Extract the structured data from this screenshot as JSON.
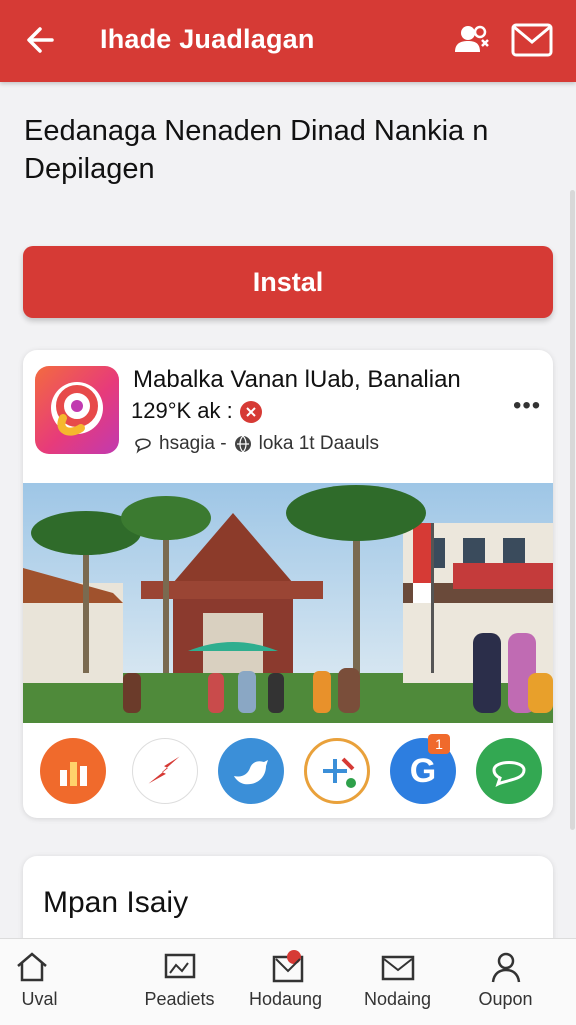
{
  "header": {
    "title": "Ihade Juadlagan",
    "back_icon": "arrow-left-icon",
    "people_icon": "people-icon",
    "mail_icon": "mail-icon"
  },
  "page_heading": "Eedanaga Nenaden Dinad Nankia n Depilagen",
  "install_button": {
    "label": "Instal"
  },
  "app_card": {
    "name": "Mabalka Vanan lUab, Banalian",
    "meta": "129°K ak :",
    "subtitle_left": "hsagia -",
    "subtitle_right": "loka 1t Daauls",
    "more_label": "•••",
    "share_icons": [
      "analytics-icon",
      "bolt-icon",
      "twitter-bird-icon",
      "tools-icon",
      "google-icon",
      "chat-icon"
    ],
    "share_badge": "1"
  },
  "second_card": {
    "title": "Mpan Isaiy"
  },
  "nav": [
    {
      "label": "Uval",
      "icon": "home-icon"
    },
    {
      "label": "Peadiets",
      "icon": "gallery-icon"
    },
    {
      "label": "Hodaung",
      "icon": "inbox-icon"
    },
    {
      "label": "Nodaing",
      "icon": "mail-icon"
    },
    {
      "label": "Oupon",
      "icon": "user-icon"
    }
  ],
  "colors": {
    "accent": "#d63a35",
    "background": "#f2f2f4"
  }
}
